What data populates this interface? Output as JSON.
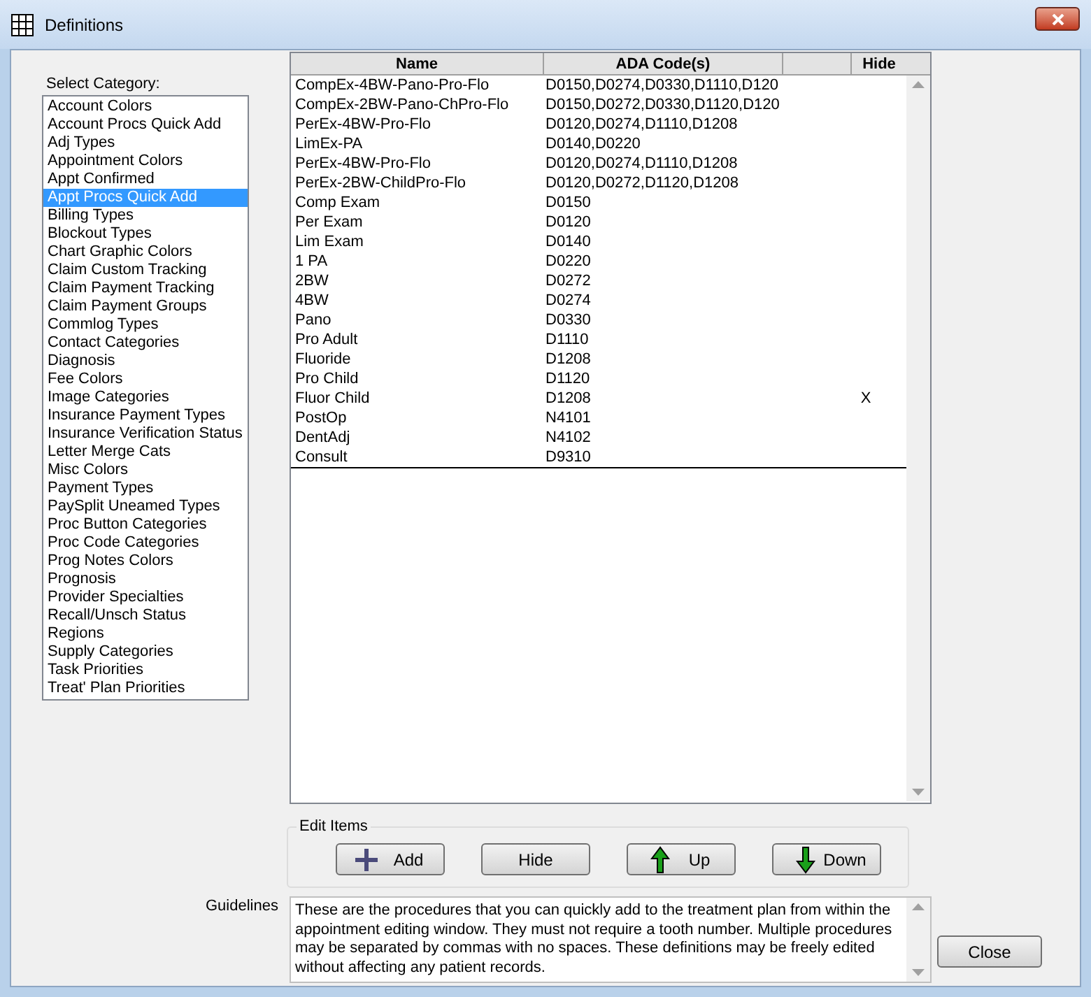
{
  "window": {
    "title": "Definitions"
  },
  "category_label": "Select Category:",
  "categories": [
    {
      "label": "Account Colors",
      "selected": false
    },
    {
      "label": "Account Procs Quick Add",
      "selected": false
    },
    {
      "label": "Adj Types",
      "selected": false
    },
    {
      "label": "Appointment Colors",
      "selected": false
    },
    {
      "label": "Appt Confirmed",
      "selected": false
    },
    {
      "label": "Appt Procs Quick Add",
      "selected": true
    },
    {
      "label": "Billing Types",
      "selected": false
    },
    {
      "label": "Blockout Types",
      "selected": false
    },
    {
      "label": "Chart Graphic Colors",
      "selected": false
    },
    {
      "label": "Claim Custom Tracking",
      "selected": false
    },
    {
      "label": "Claim Payment Tracking",
      "selected": false
    },
    {
      "label": "Claim Payment Groups",
      "selected": false
    },
    {
      "label": "Commlog Types",
      "selected": false
    },
    {
      "label": "Contact Categories",
      "selected": false
    },
    {
      "label": "Diagnosis",
      "selected": false
    },
    {
      "label": "Fee Colors",
      "selected": false
    },
    {
      "label": "Image Categories",
      "selected": false
    },
    {
      "label": "Insurance Payment Types",
      "selected": false
    },
    {
      "label": "Insurance Verification Status",
      "selected": false
    },
    {
      "label": "Letter Merge Cats",
      "selected": false
    },
    {
      "label": "Misc Colors",
      "selected": false
    },
    {
      "label": "Payment Types",
      "selected": false
    },
    {
      "label": "PaySplit Uneamed Types",
      "selected": false
    },
    {
      "label": "Proc Button Categories",
      "selected": false
    },
    {
      "label": "Proc Code Categories",
      "selected": false
    },
    {
      "label": "Prog Notes Colors",
      "selected": false
    },
    {
      "label": "Prognosis",
      "selected": false
    },
    {
      "label": "Provider Specialties",
      "selected": false
    },
    {
      "label": "Recall/Unsch Status",
      "selected": false
    },
    {
      "label": "Regions",
      "selected": false
    },
    {
      "label": "Supply Categories",
      "selected": false
    },
    {
      "label": "Task Priorities",
      "selected": false
    },
    {
      "label": "Treat' Plan Priorities",
      "selected": false
    }
  ],
  "table": {
    "columns": [
      "Name",
      "ADA Code(s)",
      "Hide"
    ],
    "rows": [
      {
        "name": "CompEx-4BW-Pano-Pro-Flo",
        "codes": "D0150,D0274,D0330,D1110,D120",
        "hide": ""
      },
      {
        "name": "CompEx-2BW-Pano-ChPro-Flo",
        "codes": "D0150,D0272,D0330,D1120,D120",
        "hide": ""
      },
      {
        "name": "PerEx-4BW-Pro-Flo",
        "codes": "D0120,D0274,D1110,D1208",
        "hide": ""
      },
      {
        "name": "LimEx-PA",
        "codes": "D0140,D0220",
        "hide": ""
      },
      {
        "name": "PerEx-4BW-Pro-Flo",
        "codes": "D0120,D0274,D1110,D1208",
        "hide": ""
      },
      {
        "name": "PerEx-2BW-ChildPro-Flo",
        "codes": "D0120,D0272,D1120,D1208",
        "hide": ""
      },
      {
        "name": "Comp Exam",
        "codes": "D0150",
        "hide": ""
      },
      {
        "name": "Per Exam",
        "codes": "D0120",
        "hide": ""
      },
      {
        "name": "Lim Exam",
        "codes": "D0140",
        "hide": ""
      },
      {
        "name": "1 PA",
        "codes": "D0220",
        "hide": ""
      },
      {
        "name": "2BW",
        "codes": "D0272",
        "hide": ""
      },
      {
        "name": "4BW",
        "codes": "D0274",
        "hide": ""
      },
      {
        "name": "Pano",
        "codes": "D0330",
        "hide": ""
      },
      {
        "name": "Pro Adult",
        "codes": "D1110",
        "hide": ""
      },
      {
        "name": "Fluoride",
        "codes": "D1208",
        "hide": ""
      },
      {
        "name": "Pro Child",
        "codes": "D1120",
        "hide": ""
      },
      {
        "name": "Fluor Child",
        "codes": "D1208",
        "hide": "X"
      },
      {
        "name": "PostOp",
        "codes": "N4101",
        "hide": ""
      },
      {
        "name": "DentAdj",
        "codes": "N4102",
        "hide": ""
      },
      {
        "name": "Consult",
        "codes": "D9310",
        "hide": ""
      }
    ]
  },
  "edit_items": {
    "title": "Edit Items",
    "buttons": [
      {
        "label": "Add",
        "kind": "add"
      },
      {
        "label": "Hide",
        "kind": "plain"
      },
      {
        "label": "Up",
        "kind": "up"
      },
      {
        "label": "Down",
        "kind": "down"
      }
    ]
  },
  "guidelines": {
    "label": "Guidelines",
    "text": "These are the procedures that you can quickly add to the treatment plan from within the appointment editing window.  They must not require a tooth number. Multiple procedures may be separated by commas with no spaces. These definitions may be freely edited without affecting any patient records."
  },
  "close_button": "Close"
}
